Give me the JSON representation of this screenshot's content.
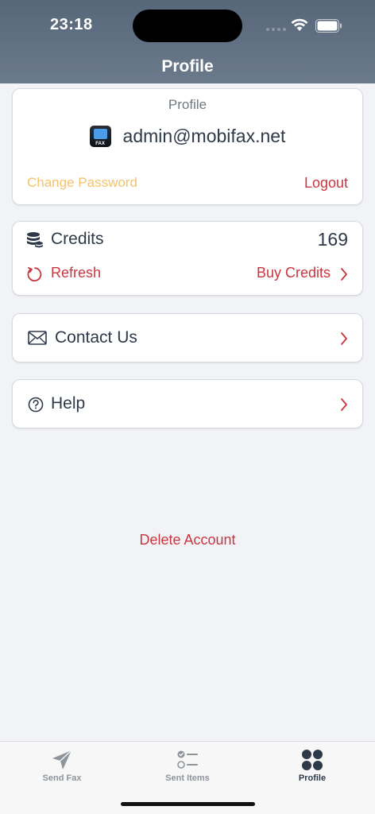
{
  "status_bar": {
    "time": "23:18"
  },
  "header": {
    "title": "Profile"
  },
  "profile_card": {
    "label": "Profile",
    "email": "admin@mobifax.net",
    "logo_text": "FAX",
    "change_password": "Change Password",
    "logout": "Logout"
  },
  "credits_card": {
    "label": "Credits",
    "value": "169",
    "refresh": "Refresh",
    "buy_credits": "Buy Credits"
  },
  "contact": {
    "label": "Contact Us"
  },
  "help": {
    "label": "Help"
  },
  "delete_account": "Delete Account",
  "tabbar": {
    "send_fax": "Send Fax",
    "sent_items": "Sent Items",
    "profile": "Profile"
  },
  "colors": {
    "header": "#5d6d80",
    "accent_red": "#c9363f",
    "accent_yellow": "#f5c26b",
    "text_dark": "#2e3a4a",
    "background": "#f2f3f7"
  }
}
